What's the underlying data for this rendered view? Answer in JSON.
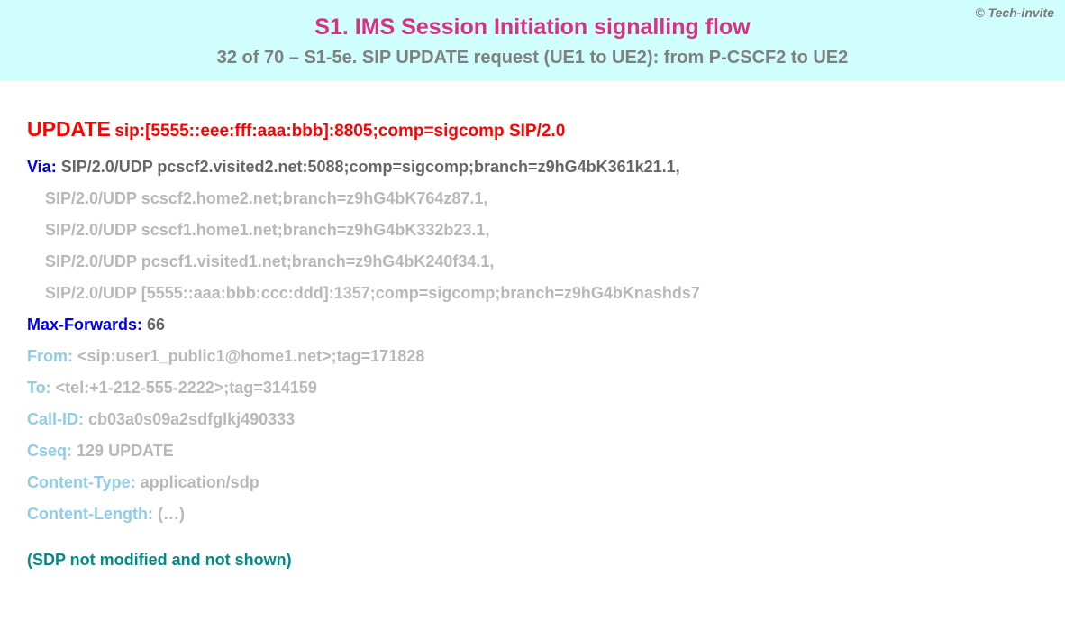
{
  "header": {
    "copyright": "© Tech-invite",
    "title": "S1. IMS Session Initiation signalling flow",
    "subtitle": "32 of 70 – S1-5e. SIP UPDATE request (UE1 to UE2): from P-CSCF2 to UE2"
  },
  "request": {
    "method": "UPDATE",
    "uri": "sip:[5555::eee:fff:aaa:bbb]:8805;comp=sigcomp SIP/2.0"
  },
  "via": {
    "label": "Via:",
    "first": "SIP/2.0/UDP pcscf2.visited2.net:5088;comp=sigcomp;branch=z9hG4bK361k21.1,",
    "cont": [
      "SIP/2.0/UDP scscf2.home2.net;branch=z9hG4bK764z87.1,",
      "SIP/2.0/UDP scscf1.home1.net;branch=z9hG4bK332b23.1,",
      "SIP/2.0/UDP pcscf1.visited1.net;branch=z9hG4bK240f34.1,",
      "SIP/2.0/UDP [5555::aaa:bbb:ccc:ddd]:1357;comp=sigcomp;branch=z9hG4bKnashds7"
    ]
  },
  "maxforwards": {
    "label": "Max-Forwards:",
    "value": "66"
  },
  "from": {
    "label": "From:",
    "value": "<sip:user1_public1@home1.net>;tag=171828"
  },
  "to": {
    "label": "To:",
    "value": "<tel:+1-212-555-2222>;tag=314159"
  },
  "callid": {
    "label": "Call-ID:",
    "value": "cb03a0s09a2sdfglkj490333"
  },
  "cseq": {
    "label": "Cseq:",
    "value": "129 UPDATE"
  },
  "ctype": {
    "label": "Content-Type:",
    "value": "application/sdp"
  },
  "clen": {
    "label": "Content-Length:",
    "value": "(…)"
  },
  "sdpnote": "(SDP not modified and not shown)"
}
